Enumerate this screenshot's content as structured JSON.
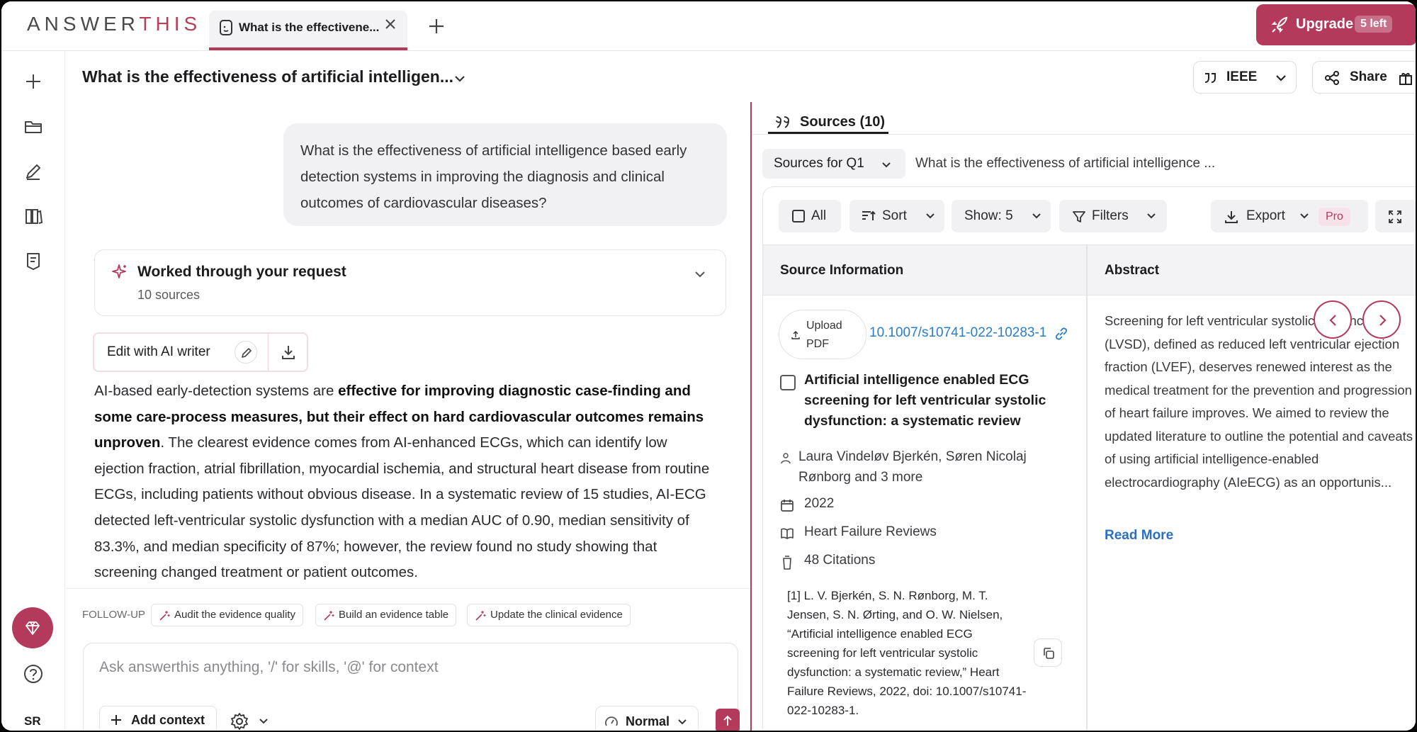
{
  "app": {
    "logo": "ANSWERTHIS",
    "tab_title": "What is the effectivene...",
    "upgrade_label": "Upgrade",
    "upgrade_badge": "5 left"
  },
  "rail": {
    "avatar_initials": "SR"
  },
  "header": {
    "doc_title": "What is the effectiveness of artificial intelligen...",
    "citation_style": "IEEE",
    "share_label": "Share"
  },
  "chat": {
    "user_question": "What is the effectiveness of artificial intelligence based early detection systems in improving the diagnosis and clinical outcomes of cardiovascular diseases?",
    "worked_title": "Worked through your request",
    "worked_sub": "10 sources",
    "edit_label": "Edit with AI writer",
    "answer_intro": "AI-based early-detection systems are ",
    "answer_bold": "effective for improving diagnostic case-finding and some care-process measures, but their effect on hard cardiovascular outcomes remains unproven",
    "answer_rest": ". The clearest evidence comes from AI-enhanced ECGs, which can identify low ejection fraction, atrial fibrillation, myocardial ischemia, and structural heart disease from routine ECGs, including patients without obvious disease. In a systematic review of 15 studies, AI-ECG detected left-ventricular systolic dysfunction with a median AUC of 0.90, median sensitivity of 83.3%, and median specificity of 87%; however, the review found no study showing that screening changed treatment or patient outcomes."
  },
  "followup": {
    "label": "FOLLOW-UP",
    "chips": [
      "Audit the evidence quality",
      "Build an evidence table",
      "Update the clinical evidence"
    ],
    "input_placeholder": "Ask answerthis anything, '/' for skills, '@' for context",
    "add_context": "Add context",
    "mode": "Normal"
  },
  "sources": {
    "tab_label": "Sources (10)",
    "scope": "Sources for Q1",
    "question_preview": "What is the effectiveness of artificial intelligence ...",
    "toolbar": {
      "all": "All",
      "sort": "Sort",
      "show": "Show: 5",
      "filters": "Filters",
      "export": "Export",
      "pro": "Pro"
    },
    "columns": [
      "Source Information",
      "Abstract"
    ],
    "row": {
      "upload_line1": "Upload",
      "upload_line2": "PDF",
      "doi": "10.1007/s10741-022-10283-1",
      "title": "Artificial intelligence enabled ECG screening for left ventricular systolic dysfunction: a systematic review",
      "authors": "Laura Vindeløv Bjerkén, Søren Nicolaj Rønborg and 3 more",
      "year": "2022",
      "journal": "Heart Failure Reviews",
      "citations": "48 Citations",
      "citation_text": "[1] L. V. Bjerkén, S. N. Rønborg, M. T. Jensen, S. N. Ørting, and O. W. Nielsen, “Artificial intelligence enabled ECG screening for left ventricular systolic dysfunction: a systematic review,” Heart Failure Reviews, 2022, doi: 10.1007/s10741-022-10283-1.",
      "abstract": "Screening for left ventricular systolic dysfunction (LVSD), defined as reduced left ventricular ejection fraction (LVEF), deserves renewed interest as the medical treatment for the prevention and progression of heart failure improves. We aimed to review the updated literature to outline the potential and caveats of using artificial intelligence-enabled electrocardiography (AIeECG) as an opportunis...",
      "read_more": "Read More"
    }
  },
  "colors": {
    "brand": "#b33a5a",
    "link": "#2b7dc5"
  }
}
